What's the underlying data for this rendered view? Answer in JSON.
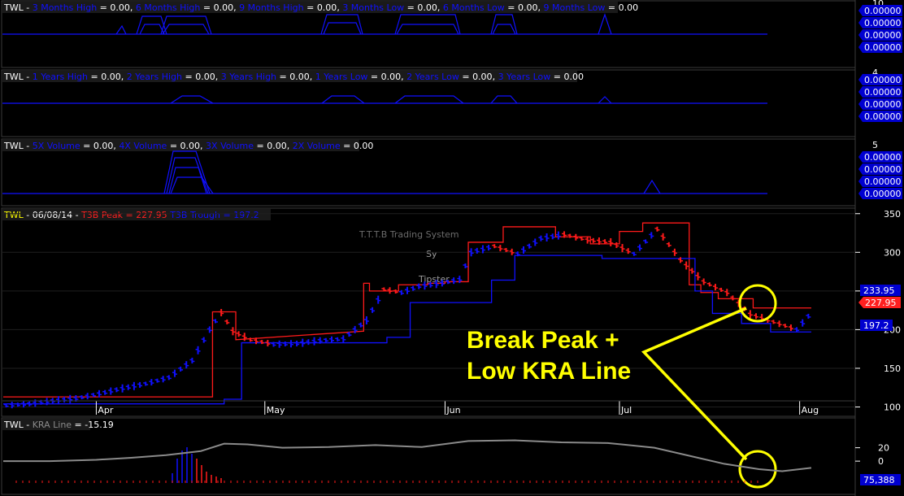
{
  "colors": {
    "bg": "#000000",
    "panel_bg": "#0a0a0a",
    "grid": "#1f1f1f",
    "blue": "#1010ff",
    "dark_blue": "#0000c0",
    "red": "#ff1a1a",
    "white": "#ffffff",
    "yellow": "#ffff00",
    "gray": "#8a8a8a",
    "label_box_blue": "#0000d0",
    "label_box_red": "#ff2020"
  },
  "panels": {
    "p1": {
      "ticker": "TWL",
      "sep": " - ",
      "items": [
        {
          "name": "3 Months High",
          "value": "0.00",
          "sep": ", "
        },
        {
          "name": "6 Months High",
          "value": "0.00",
          "sep": ", "
        },
        {
          "name": "9 Months High",
          "value": "0.00",
          "sep": ", "
        },
        {
          "name": "3 Months Low",
          "value": "0.00",
          "sep": ", "
        },
        {
          "name": "6 Months Low",
          "value": "0.00",
          "sep": ", "
        },
        {
          "name": "9 Months Low",
          "value": "0.00",
          "sep": ""
        }
      ],
      "axis_top": "10",
      "value_boxes": [
        "0.00000",
        "0.00000",
        "0.00000",
        "0.00000"
      ]
    },
    "p2": {
      "ticker": "TWL",
      "sep": " - ",
      "items": [
        {
          "name": "1 Years High",
          "value": "0.00",
          "sep": ", "
        },
        {
          "name": "2 Years High",
          "value": "0.00",
          "sep": ", "
        },
        {
          "name": "3 Years High",
          "value": "0.00",
          "sep": ", "
        },
        {
          "name": "1 Years Low",
          "value": "0.00",
          "sep": ", "
        },
        {
          "name": "2 Years Low",
          "value": "0.00",
          "sep": ", "
        },
        {
          "name": "3 Years Low",
          "value": "0.00",
          "sep": ""
        }
      ],
      "axis_top": "4",
      "value_boxes": [
        "0.00000",
        "0.00000",
        "0.00000",
        "0.00000"
      ]
    },
    "p3": {
      "ticker": "TWL",
      "sep": " - ",
      "items": [
        {
          "name": "5X Volume",
          "value": "0.00",
          "sep": ", "
        },
        {
          "name": "4X Volume",
          "value": "0.00",
          "sep": ", "
        },
        {
          "name": "3X Volume",
          "value": "0.00",
          "sep": ", "
        },
        {
          "name": "2X Volume",
          "value": "0.00",
          "sep": ""
        }
      ],
      "axis_top": "5",
      "value_boxes": [
        "0.00000",
        "0.00000",
        "0.00000",
        "0.00000"
      ]
    },
    "main": {
      "ticker": "TWL",
      "date": "06/08/14",
      "peak_label": "T3B Peak",
      "peak_value": "227.95",
      "trough_label": "T3B Trough",
      "trough_value": "197.2",
      "watermark": "T.T.T.B Trading System",
      "mini_label_1": "Sy",
      "mini_label_2": "Tipster",
      "price_box_top": "233.95",
      "price_box_peak": "227.95",
      "price_box_trough": "197.2",
      "annotation_line1": "Break Peak +",
      "annotation_line2": "Low KRA Line"
    },
    "kra": {
      "ticker": "TWL",
      "name": "KRA Line",
      "value": "-15.19",
      "ticks": [
        "20",
        "0"
      ],
      "value_box": "75,388"
    }
  },
  "chart_data": [
    {
      "type": "line",
      "panel": "T3B price",
      "y_ticks": [
        100,
        150,
        200,
        250,
        300,
        350
      ],
      "ylim": [
        90,
        355
      ],
      "x_ticks": [
        "Apr",
        "May",
        "Jun",
        "Jul",
        "Aug"
      ],
      "x_tick_days": [
        16,
        45,
        76,
        106,
        137
      ],
      "xlim": [
        0,
        146
      ],
      "series": [
        {
          "name": "T3B Peak",
          "color": "red",
          "x": [
            0,
            36,
            36,
            40,
            40,
            62,
            62,
            63,
            63,
            68,
            68,
            73,
            73,
            76,
            76,
            80,
            80,
            86,
            86,
            95,
            95,
            101,
            101,
            106,
            106,
            110,
            110,
            113,
            113,
            118,
            118,
            120,
            120,
            123,
            123,
            129,
            129,
            139
          ],
          "y": [
            113,
            113,
            223,
            223,
            187,
            198,
            260,
            260,
            250,
            250,
            258,
            258,
            260,
            260,
            262,
            262,
            313,
            313,
            333,
            333,
            320,
            320,
            311,
            311,
            327,
            327,
            338,
            338,
            338,
            338,
            258,
            258,
            248,
            248,
            240,
            240,
            228,
            228
          ]
        },
        {
          "name": "T3B Trough",
          "color": "blue",
          "x": [
            0,
            38,
            38,
            41,
            41,
            66,
            66,
            70,
            70,
            84,
            84,
            88,
            88,
            98,
            98,
            103,
            103,
            119,
            119,
            122,
            122,
            127,
            127,
            132,
            132,
            139
          ],
          "y": [
            104,
            104,
            110,
            110,
            183,
            183,
            190,
            190,
            235,
            235,
            264,
            264,
            296,
            296,
            296,
            296,
            292,
            292,
            250,
            250,
            221,
            221,
            208,
            208,
            197,
            197
          ]
        },
        {
          "name": "Price",
          "color": "mixed",
          "x": [
            0,
            4,
            8,
            12,
            16,
            20,
            24,
            28,
            32,
            35,
            37,
            39,
            42,
            46,
            50,
            54,
            58,
            62,
            65,
            68,
            71,
            75,
            78,
            80,
            84,
            88,
            92,
            96,
            100,
            104,
            108,
            112,
            116,
            120,
            124,
            128,
            132,
            136,
            139
          ],
          "y": [
            102,
            104,
            108,
            111,
            117,
            124,
            130,
            138,
            160,
            200,
            222,
            198,
            187,
            181,
            182,
            186,
            188,
            212,
            252,
            248,
            256,
            260,
            265,
            300,
            308,
            298,
            318,
            323,
            316,
            313,
            298,
            330,
            290,
            262,
            248,
            220,
            210,
            200,
            226
          ]
        }
      ]
    },
    {
      "type": "line",
      "panel": "KRA Line",
      "y_ticks": [
        20,
        0
      ],
      "ylim": [
        -35,
        45
      ],
      "xlim": [
        0,
        146
      ],
      "series": [
        {
          "name": "KRA Line",
          "color": "gray",
          "x": [
            0,
            8,
            16,
            22,
            28,
            34,
            38,
            42,
            48,
            56,
            64,
            72,
            80,
            88,
            96,
            104,
            112,
            118,
            124,
            130,
            134,
            139
          ],
          "y": [
            0,
            0,
            2,
            5,
            9,
            15,
            26,
            25,
            20,
            21,
            24,
            21,
            30,
            31,
            28,
            27,
            20,
            8,
            -4,
            -12,
            -15,
            -10
          ]
        }
      ]
    }
  ]
}
